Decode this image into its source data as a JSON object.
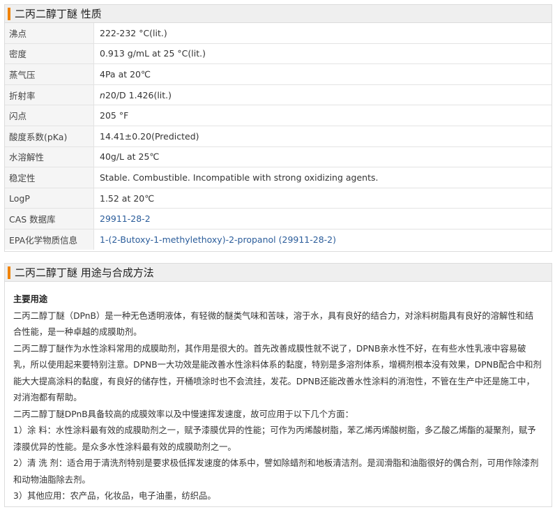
{
  "section1": {
    "title": "二丙二醇丁醚 性质",
    "rows": [
      {
        "key": "沸点",
        "value": "222-232 °C(lit.)"
      },
      {
        "key": "密度",
        "value": "0.913 g/mL at 25 °C(lit.)"
      },
      {
        "key": "蒸气压",
        "value": "4Pa at 20℃"
      },
      {
        "key": "折射率",
        "value_prefix": "n",
        "value": "20/D 1.426(lit.)"
      },
      {
        "key": "闪点",
        "value": "205 °F"
      },
      {
        "key": "酸度系数(pKa)",
        "value": "14.41±0.20(Predicted)"
      },
      {
        "key": "水溶解性",
        "value": "40g/L at 25℃"
      },
      {
        "key": "稳定性",
        "value": "Stable. Combustible. Incompatible with strong oxidizing agents."
      },
      {
        "key": "LogP",
        "value": "1.52 at 20℃"
      },
      {
        "key": "CAS 数据库",
        "value": "29911-28-2"
      },
      {
        "key": "EPA化学物质信息",
        "value": "1-(2-Butoxy-1-methylethoxy)-2-propanol (29911-28-2)"
      }
    ]
  },
  "section2": {
    "title": "二丙二醇丁醚 用途与合成方法",
    "subtitle": "主要用途",
    "paragraphs": [
      "二丙二醇丁醚（DPnB）是一种无色透明液体，有轻微的醚类气味和苦味，溶于水，具有良好的结合力，对涂料树脂具有良好的溶解性和结合性能，是一种卓越的成膜助剂。",
      "二丙二醇丁醚作为水性涂料常用的成膜助剂，其作用是很大的。首先改善成膜性就不说了，DPNB亲水性不好，在有些水性乳液中容易破乳，所以使用起来要特别注意。DPNB一大功效是能改善水性涂料体系的黏度，特别是多溶剂体系，增稠剂根本没有效果，DPNB配合中和剂能大大提高涂料的黏度，有良好的储存性，开桶喷涂时也不会流挂，发花。DPNB还能改善水性涂料的消泡性，不管在生产中还是施工中，对消泡都有帮助。",
      "二丙二醇丁醚DPnB具备较高的成膜效率以及中慢速挥发速度，故可应用于以下几个方面：",
      "1）涂 料：水性涂料最有效的成膜助剂之一，赋予漆膜优异的性能；可作为丙烯酸树脂，苯乙烯丙烯酸树脂，多乙酸乙烯酯的凝聚剂，赋予漆膜优异的性能。是众多水性涂料最有效的成膜助剂之一。",
      "2）清 洗 剂：适合用于清洗剂特别是要求极低挥发速度的体系中，譬如除蜡剂和地板清洁剂。是润滑脂和油脂很好的偶合剂，可用作除漆剂和动物油脂除去剂。",
      "3）其他应用：农产品，化妆品，电子油墨，纺织品。"
    ]
  },
  "colors": {
    "accent": "#f08300",
    "link": "#2a5c9a",
    "header_bg": "#efefef",
    "key_bg": "#f5f5f5"
  }
}
